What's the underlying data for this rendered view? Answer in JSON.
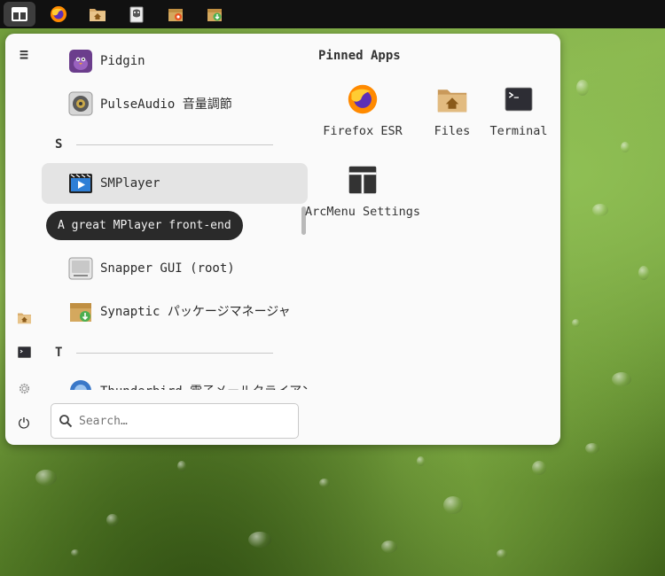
{
  "panel": {
    "icons": [
      "arcmenu-icon",
      "firefox-icon",
      "home-folder-icon",
      "gimp-icon",
      "software-package-icon",
      "package-install-icon"
    ]
  },
  "sidebar": {
    "menu_icon": "≡",
    "items": [
      "home-folder-icon",
      "terminal-icon",
      "settings-icon"
    ],
    "power_icon": "⏻"
  },
  "apps": {
    "items": [
      {
        "label": "Pidgin"
      },
      {
        "label": "PulseAudio 音量調節"
      },
      {
        "label": "SMPlayer"
      },
      {
        "label": "Snapper GUI (root)"
      },
      {
        "label": "Synaptic パッケージマネージャ"
      },
      {
        "label": "Thunderbird 電子メールクライアント"
      }
    ],
    "sections": [
      "S",
      "T"
    ],
    "tooltip": "A great MPlayer front-end"
  },
  "pinned": {
    "title": "Pinned Apps",
    "items": [
      {
        "label": "Firefox ESR"
      },
      {
        "label": "Files"
      },
      {
        "label": "Terminal"
      },
      {
        "label": "ArcMenu Settings"
      }
    ]
  },
  "search": {
    "placeholder": "Search…",
    "value": ""
  },
  "colors": {
    "menu_bg": "#fafafa",
    "highlight": "#e4e4e4",
    "tooltip_bg": "#2a2a2a",
    "panel_bg": "#111111"
  }
}
